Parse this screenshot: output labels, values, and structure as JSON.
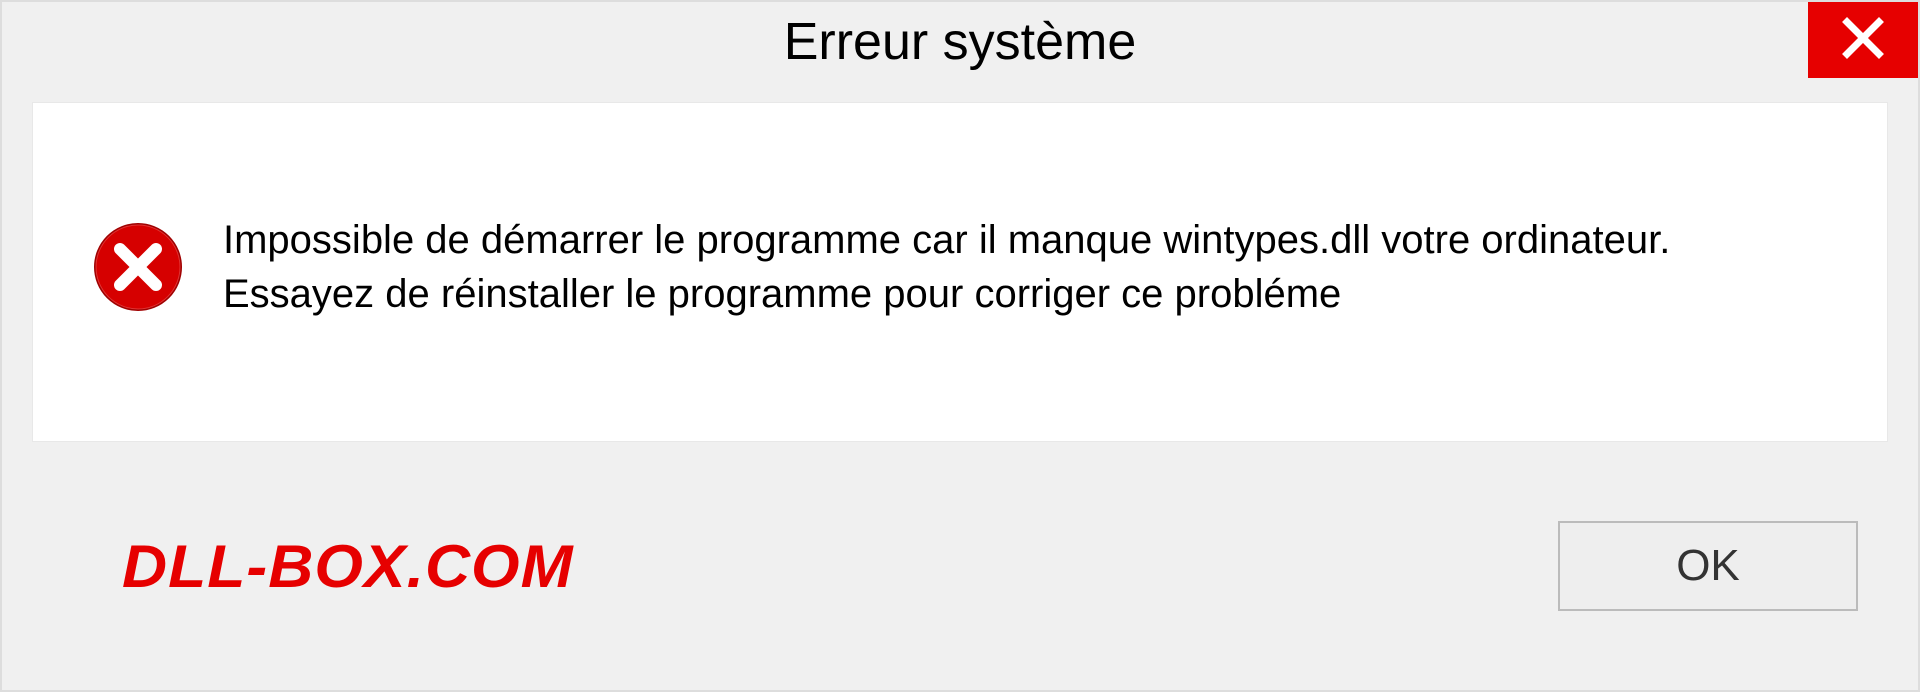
{
  "dialog": {
    "title": "Erreur système",
    "message": "Impossible de démarrer le programme car il manque wintypes.dll votre ordinateur. Essayez de réinstaller le programme pour corriger ce probléme",
    "watermark": "DLL-BOX.COM",
    "ok_label": "OK"
  }
}
